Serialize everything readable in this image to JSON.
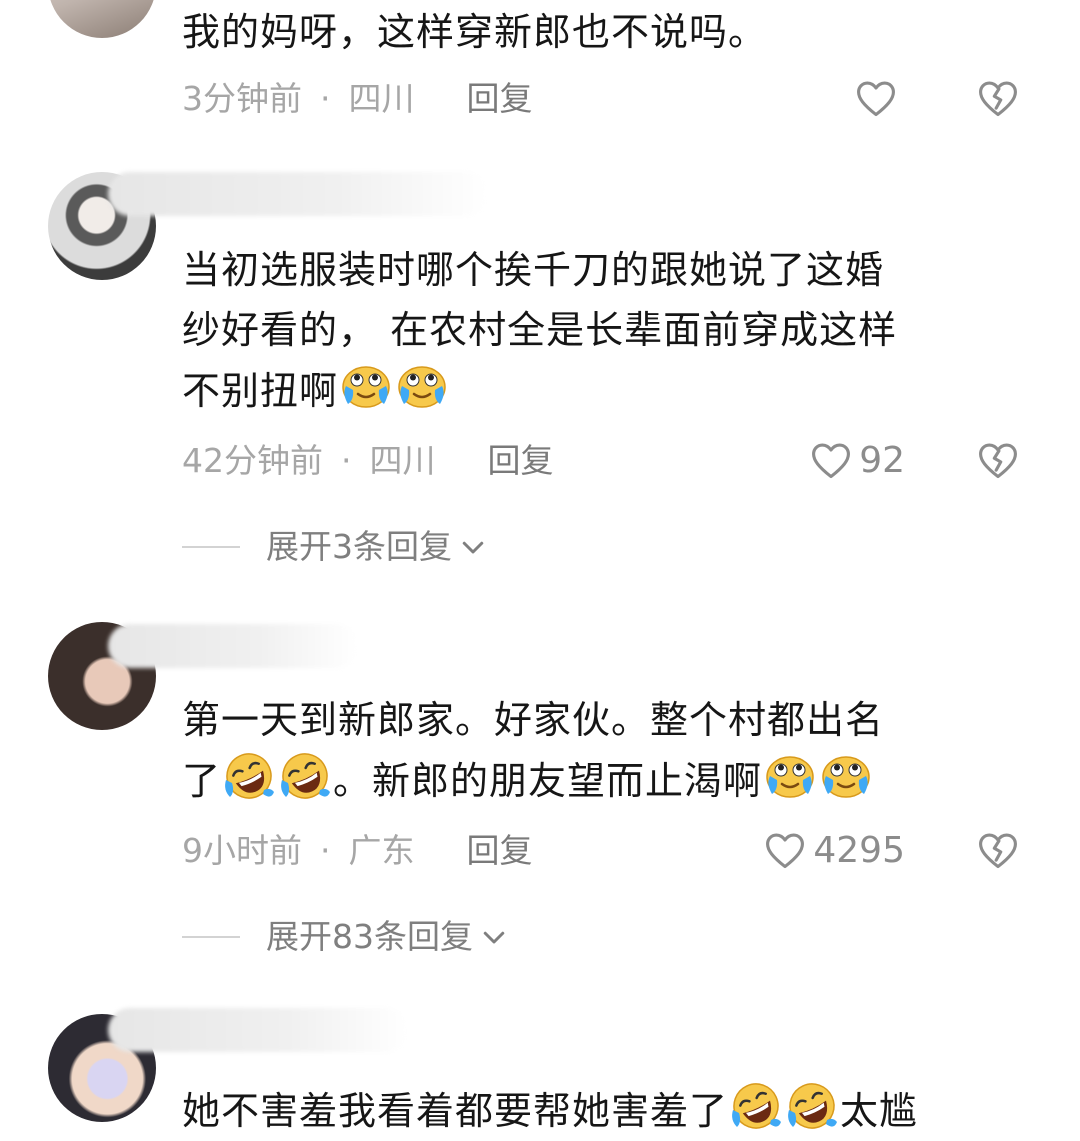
{
  "comments": [
    {
      "text_lines": [
        "我的妈呀，这样穿新郎也不说吗。"
      ],
      "time": "3分钟前",
      "location": "四川",
      "reply_label": "回复",
      "likes": ""
    },
    {
      "text_lines": [
        "当初选服装时哪个挨千刀的跟她说了这婚",
        "纱好看的， 在农村全是长辈面前穿成这样",
        "不别扭啊"
      ],
      "time": "42分钟前",
      "location": "四川",
      "reply_label": "回复",
      "likes": "92",
      "expand_label": "展开3条回复"
    },
    {
      "text_lines": [
        "第一天到新郎家。好家伙。整个村都出名",
        "了",
        "。新郎的朋友望而止渴啊"
      ],
      "time": "9小时前",
      "location": "广东",
      "reply_label": "回复",
      "likes": "4295",
      "expand_label": "展开83条回复"
    },
    {
      "text_lines": [
        "她不害羞我看着都要帮她害羞了",
        "太尴"
      ]
    }
  ],
  "separator": "·",
  "icons": {
    "like": "heart-outline-icon",
    "dislike": "broken-heart-icon",
    "expand": "chevron-down-icon",
    "emoji_tears": "tearful-face-emoji",
    "emoji_laugh": "rolling-laughing-emoji"
  }
}
